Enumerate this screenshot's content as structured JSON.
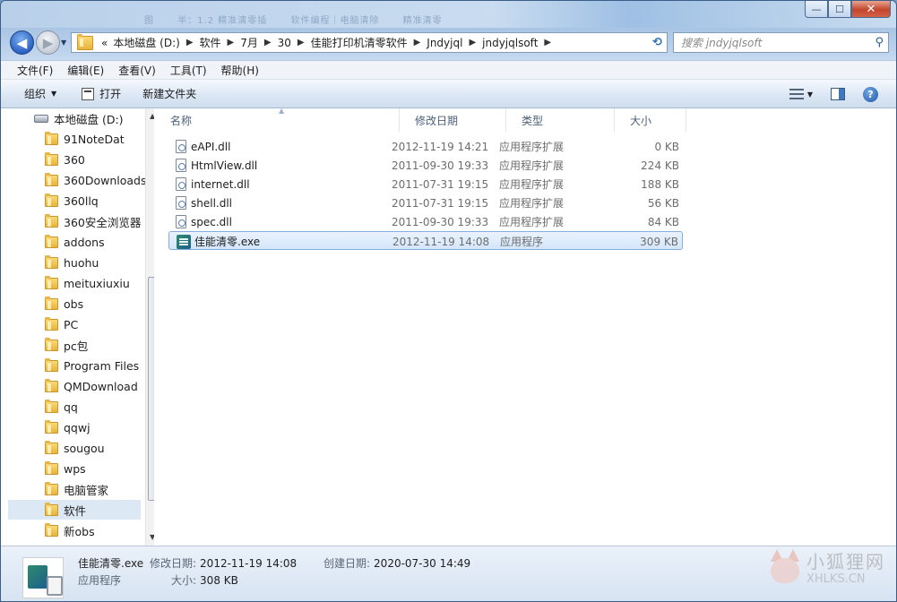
{
  "window": {
    "title_ghost": [
      "图",
      "半：1.2 精准清零插",
      "软件编程｜电脑清除",
      "精准清零"
    ],
    "caption": {
      "minimize": "—",
      "maximize": "☐",
      "close": "✕"
    }
  },
  "nav": {
    "back": "◀",
    "forward": "▶",
    "crumbs_prefix": "«",
    "crumbs": [
      "本地磁盘 (D:)",
      "软件",
      "7月",
      "30",
      "佳能打印机清零软件",
      "Jndyjql",
      "jndyjqlsoft"
    ],
    "search_placeholder": "搜索 jndyjqlsoft"
  },
  "menu": [
    "文件(F)",
    "编辑(E)",
    "查看(V)",
    "工具(T)",
    "帮助(H)"
  ],
  "toolbar": {
    "organize": "组织",
    "open": "打开",
    "new_folder": "新建文件夹"
  },
  "tree": {
    "drive": "本地磁盘 (D:)",
    "folders": [
      "91NoteDat",
      "360",
      "360Downloads",
      "360llq",
      "360安全浏览器",
      "addons",
      "huohu",
      "meituxiuxiu",
      "obs",
      "PC",
      "pc包",
      "Program Files",
      "QMDownload",
      "qq",
      "qqwj",
      "sougou",
      "wps",
      "电脑管家",
      "软件",
      "新obs"
    ],
    "selected": "软件"
  },
  "columns": {
    "name": "名称",
    "date": "修改日期",
    "type": "类型",
    "size": "大小"
  },
  "files": [
    {
      "name": "eAPI.dll",
      "date": "2012-11-19 14:21",
      "type": "应用程序扩展",
      "size": "0 KB",
      "icon": "dll-icon"
    },
    {
      "name": "HtmlView.dll",
      "date": "2011-09-30 19:33",
      "type": "应用程序扩展",
      "size": "224 KB",
      "icon": "dll-icon"
    },
    {
      "name": "internet.dll",
      "date": "2011-07-31 19:15",
      "type": "应用程序扩展",
      "size": "188 KB",
      "icon": "dll-icon"
    },
    {
      "name": "shell.dll",
      "date": "2011-07-31 19:15",
      "type": "应用程序扩展",
      "size": "56 KB",
      "icon": "dll-icon"
    },
    {
      "name": "spec.dll",
      "date": "2011-09-30 19:33",
      "type": "应用程序扩展",
      "size": "84 KB",
      "icon": "dll-icon"
    },
    {
      "name": "佳能清零.exe",
      "date": "2012-11-19 14:08",
      "type": "应用程序",
      "size": "309 KB",
      "icon": "exe-icon",
      "selected": true
    }
  ],
  "details": {
    "filename": "佳能清零.exe",
    "type": "应用程序",
    "modified_label": "修改日期:",
    "modified": "2012-11-19 14:08",
    "size_label": "大小:",
    "size": "308 KB",
    "created_label": "创建日期:",
    "created": "2020-07-30 14:49"
  },
  "watermark": {
    "text": "小狐狸网",
    "site": "XHLKS.CN"
  }
}
